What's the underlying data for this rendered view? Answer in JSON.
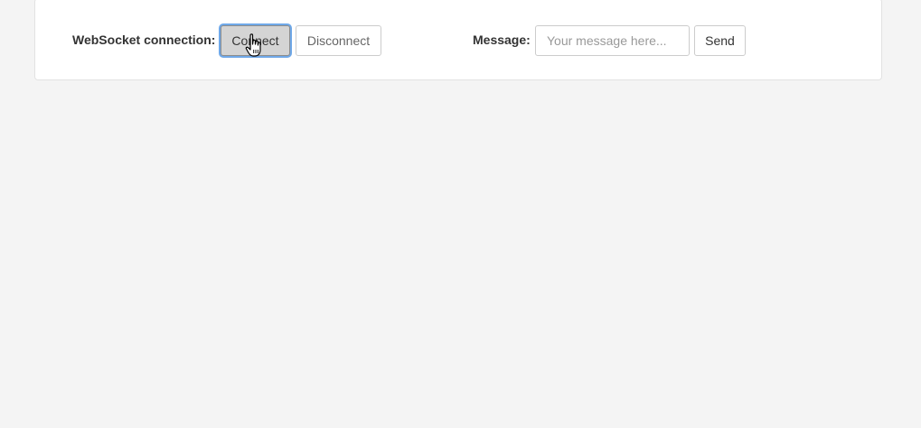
{
  "websocket": {
    "label": "WebSocket connection:",
    "connect_label": "Connect",
    "disconnect_label": "Disconnect"
  },
  "message": {
    "label": "Message:",
    "input_value": "",
    "input_placeholder": "Your message here...",
    "send_label": "Send"
  },
  "cursor": {
    "icon": "hand-pointer-icon"
  },
  "colors": {
    "background": "#f4f4f4",
    "panel": "#ffffff",
    "focus_ring": "#6fa8e8",
    "active_button": "#d4d4d4"
  }
}
